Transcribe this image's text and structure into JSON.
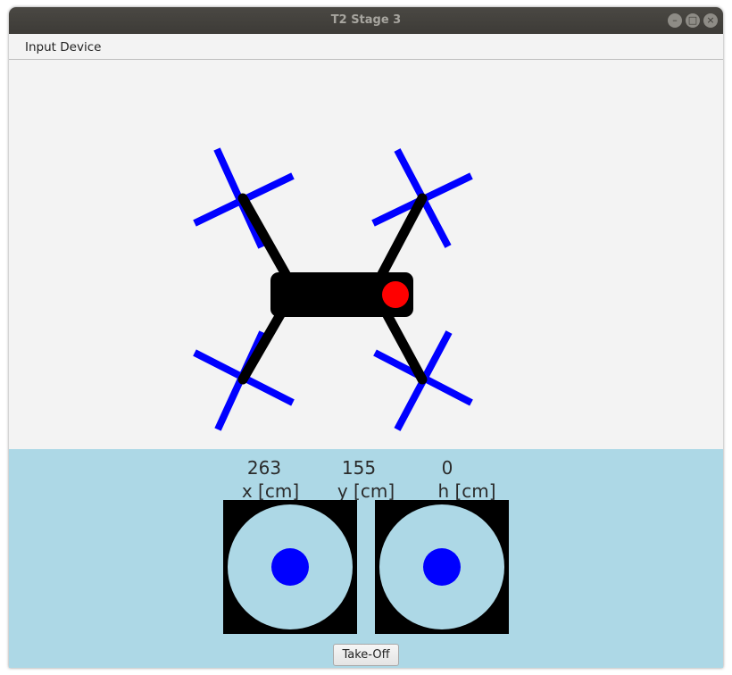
{
  "window": {
    "title": "T2 Stage 3",
    "controls": {
      "minimize_icon": "–",
      "maximize_icon": "□",
      "close_icon": "×"
    }
  },
  "menu": {
    "items": [
      "Input Device"
    ]
  },
  "drone": {
    "body_color": "#000000",
    "propeller_color": "#0000ff",
    "nose_indicator_color": "#ff0000"
  },
  "readouts": {
    "x": {
      "value": "263",
      "label": "x [cm]"
    },
    "y": {
      "value": "155",
      "label": "y [cm]"
    },
    "h": {
      "value": "0",
      "label": "h [cm]"
    }
  },
  "joysticks": {
    "left": {
      "knob_x": 0,
      "knob_y": 0
    },
    "right": {
      "knob_x": 0,
      "knob_y": 0
    },
    "ring_color": "#add8e6",
    "knob_color": "#0000ff"
  },
  "buttons": {
    "takeoff_label": "Take-Off"
  },
  "colors": {
    "panel_background": "#add8e6",
    "canvas_background": "#f3f3f3"
  }
}
